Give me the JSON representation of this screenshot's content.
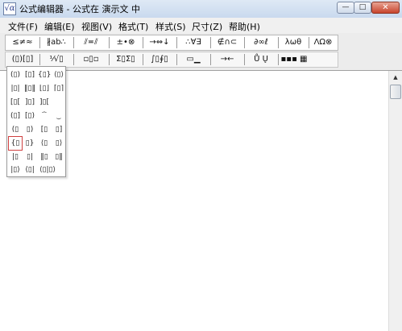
{
  "window": {
    "title": "公式编辑器 - 公式在 演示文 中",
    "icon": "equation-editor-app-icon",
    "icon_glyph": "√α",
    "min_glyph": "—",
    "max_glyph": "□",
    "close_glyph": "✕"
  },
  "menu": [
    {
      "label": "文件(F)"
    },
    {
      "label": "编辑(E)"
    },
    {
      "label": "视图(V)"
    },
    {
      "label": "格式(T)"
    },
    {
      "label": "样式(S)"
    },
    {
      "label": "尺寸(Z)"
    },
    {
      "label": "帮助(H)"
    }
  ],
  "toolbar_row1": [
    {
      "glyph": "≤≠≈",
      "icon": "relational-symbols-icon"
    },
    {
      "glyph": "∦ab∴",
      "icon": "spaces-ellipses-icon"
    },
    {
      "glyph": "⫽≖⫽",
      "icon": "embellishments-icon"
    },
    {
      "glyph": "±•⊗",
      "icon": "operator-symbols-icon"
    },
    {
      "glyph": "→⇔↓",
      "icon": "arrow-symbols-icon"
    },
    {
      "glyph": "∴∀∃",
      "icon": "logical-symbols-icon"
    },
    {
      "glyph": "∉∩⊂",
      "icon": "set-theory-symbols-icon"
    },
    {
      "glyph": "∂∞ℓ",
      "icon": "misc-symbols-icon"
    },
    {
      "glyph": "λωθ",
      "icon": "greek-lowercase-icon"
    },
    {
      "glyph": "ΛΩ⊗",
      "icon": "greek-uppercase-icon"
    }
  ],
  "toolbar_row2": [
    {
      "glyph": "(▯)[▯]",
      "icon": "fence-templates-icon"
    },
    {
      "glyph": "⅟√▯",
      "icon": "fraction-radical-templates-icon"
    },
    {
      "glyph": "▫▯▫",
      "icon": "subscript-superscript-templates-icon"
    },
    {
      "glyph": "Σ▯Σ▯",
      "icon": "summation-templates-icon"
    },
    {
      "glyph": "∫▯∮▯",
      "icon": "integral-templates-icon"
    },
    {
      "glyph": "▭▁",
      "icon": "underbar-overbar-templates-icon"
    },
    {
      "glyph": "→←",
      "icon": "labeled-arrow-templates-icon"
    },
    {
      "glyph": "Ů Ų",
      "icon": "products-set-theory-templates-icon"
    },
    {
      "glyph": "▪▪▪ ▦",
      "icon": "matrix-templates-icon"
    }
  ],
  "palette": {
    "rows": [
      [
        {
          "glyph": "(▯)",
          "icon": "parentheses-template-icon"
        },
        {
          "glyph": "[▯]",
          "icon": "brackets-template-icon"
        },
        {
          "glyph": "{▯}",
          "icon": "braces-template-icon"
        },
        {
          "glyph": "⟨▯⟩",
          "icon": "angle-brackets-template-icon"
        }
      ],
      [
        {
          "glyph": "|▯|",
          "icon": "absolute-value-template-icon"
        },
        {
          "glyph": "‖▯‖",
          "icon": "norm-template-icon"
        },
        {
          "glyph": "⌊▯⌋",
          "icon": "floor-template-icon"
        },
        {
          "glyph": "⌈▯⌉",
          "icon": "ceiling-template-icon"
        }
      ],
      [
        {
          "glyph": "[▯[",
          "icon": "left-bracket-pair-template-icon"
        },
        {
          "glyph": "]▯]",
          "icon": "right-bracket-pair-template-icon"
        },
        {
          "glyph": "]▯[",
          "icon": "reversed-brackets-template-icon"
        }
      ],
      [
        {
          "glyph": "(▯]",
          "icon": "half-open-left-template-icon"
        },
        {
          "glyph": "[▯)",
          "icon": "half-open-right-template-icon"
        },
        {
          "glyph": "⏞",
          "icon": "overbrace-template-icon"
        },
        {
          "glyph": "⏟",
          "icon": "underbrace-template-icon"
        }
      ],
      [
        {
          "glyph": "(▯",
          "icon": "left-parenthesis-template-icon"
        },
        {
          "glyph": "▯)",
          "icon": "right-parenthesis-template-icon"
        },
        {
          "glyph": "[▯",
          "icon": "left-bracket-template-icon"
        },
        {
          "glyph": "▯]",
          "icon": "right-bracket-template-icon"
        }
      ],
      [
        {
          "glyph": "{▯",
          "icon": "left-brace-template-icon",
          "selected": true
        },
        {
          "glyph": "▯}",
          "icon": "right-brace-template-icon"
        },
        {
          "glyph": "⟨▯",
          "icon": "left-angle-template-icon"
        },
        {
          "glyph": "▯⟩",
          "icon": "right-angle-template-icon"
        }
      ],
      [
        {
          "glyph": "|▯",
          "icon": "left-bar-template-icon"
        },
        {
          "glyph": "▯|",
          "icon": "right-bar-template-icon"
        },
        {
          "glyph": "‖▯",
          "icon": "left-double-bar-template-icon"
        },
        {
          "glyph": "▯‖",
          "icon": "right-double-bar-template-icon"
        }
      ],
      [
        {
          "glyph": "|▯⟩",
          "icon": "ket-template-icon"
        },
        {
          "glyph": "⟨▯|",
          "icon": "bra-template-icon"
        },
        {
          "glyph": "⟨▯|▯⟩",
          "icon": "bra-ket-template-icon"
        }
      ]
    ]
  },
  "scrollbar": {
    "up_glyph": "▲"
  }
}
